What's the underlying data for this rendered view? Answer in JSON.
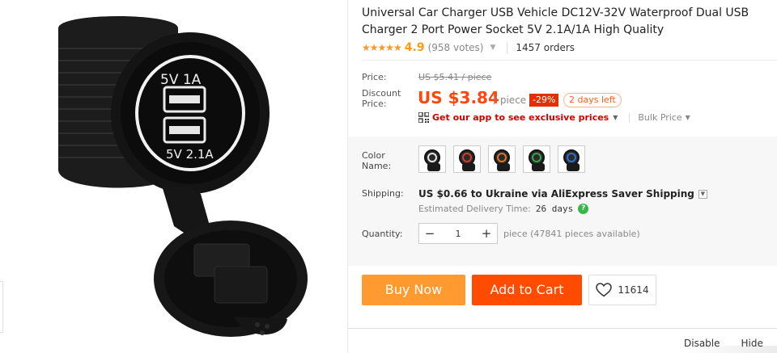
{
  "product": {
    "title": "Universal Car Charger USB Vehicle DC12V-32V Waterproof Dual USB Charger 2 Port Power Socket 5V 2.1A/1A High Quality",
    "image_labels": {
      "top_port": "5V  1A",
      "bottom_port": "5V 2.1A"
    }
  },
  "rating": {
    "stars": "★★★★★",
    "score": "4.9",
    "votes": "(958 votes)",
    "orders": "1457 orders"
  },
  "price": {
    "price_label": "Price:",
    "original": "US $5.41 / piece",
    "discount_label": "Discount Price:",
    "current": "US $3.84",
    "unit": "/ piece",
    "discount_percent": "-29%",
    "time_left": "2 days left",
    "app_promo": "Get our app to see exclusive prices",
    "bulk_price": "Bulk Price"
  },
  "options": {
    "color_label": "Color Name:",
    "colors": [
      {
        "name": "white",
        "accent": "#e8e8e8"
      },
      {
        "name": "red",
        "accent": "#d83a2a"
      },
      {
        "name": "orange",
        "accent": "#e2731f"
      },
      {
        "name": "green",
        "accent": "#2fa84a"
      },
      {
        "name": "blue",
        "accent": "#2a6fd8"
      }
    ],
    "shipping_label": "Shipping:",
    "shipping_text": "US $0.66 to Ukraine via AliExpress Saver Shipping",
    "delivery_label": "Estimated Delivery Time:",
    "delivery_days": "26 days",
    "help": "?",
    "quantity_label": "Quantity:",
    "quantity_minus": "−",
    "quantity_value": "1",
    "quantity_plus": "+",
    "quantity_available": "piece (47841 pieces available)"
  },
  "actions": {
    "buy_now": "Buy Now",
    "add_to_cart": "Add to Cart",
    "wishlist_count": "11614"
  },
  "bottom_bar": {
    "disable": "Disable",
    "hide": "Hide"
  },
  "colors": {
    "accent_orange": "#ff4611",
    "buy_now_bg": "#ff9a30",
    "add_to_cart_bg": "#ff4c00",
    "star": "#ff9a15"
  }
}
